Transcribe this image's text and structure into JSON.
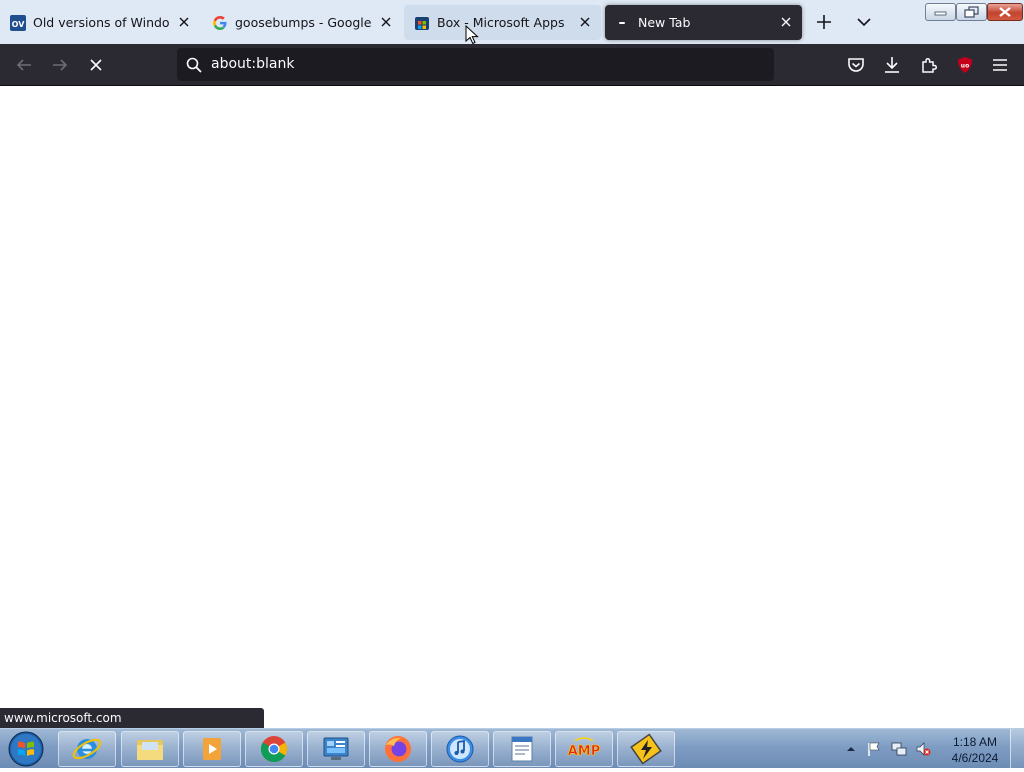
{
  "tabs": [
    {
      "title": "Old versions of Windows, Li",
      "favicon": "oldversion-favicon"
    },
    {
      "title": "goosebumps - Google Search",
      "favicon": "google-favicon"
    },
    {
      "title": "Box - Microsoft Apps",
      "favicon": "microsoft-store-favicon"
    },
    {
      "title": "New Tab",
      "favicon": "loading-dot-icon"
    }
  ],
  "favicon_text": {
    "oldversion": "OV"
  },
  "urlbar": {
    "value": "about:blank"
  },
  "status_text": "www.microsoft.com",
  "taskbar": {
    "apps": [
      "internet-explorer",
      "file-explorer",
      "media-player",
      "chrome",
      "control-panel",
      "firefox",
      "itunes",
      "wordpad",
      "winamp",
      "unknown-app"
    ],
    "clock": {
      "time": "1:18 AM",
      "date": "4/6/2024"
    },
    "amp_label": "AMP"
  },
  "colors": {
    "toolbar": "#2b2a33",
    "tabstrip": "#dfe9f5",
    "urlbar": "#1c1b22",
    "ublock": "#c4001a"
  }
}
